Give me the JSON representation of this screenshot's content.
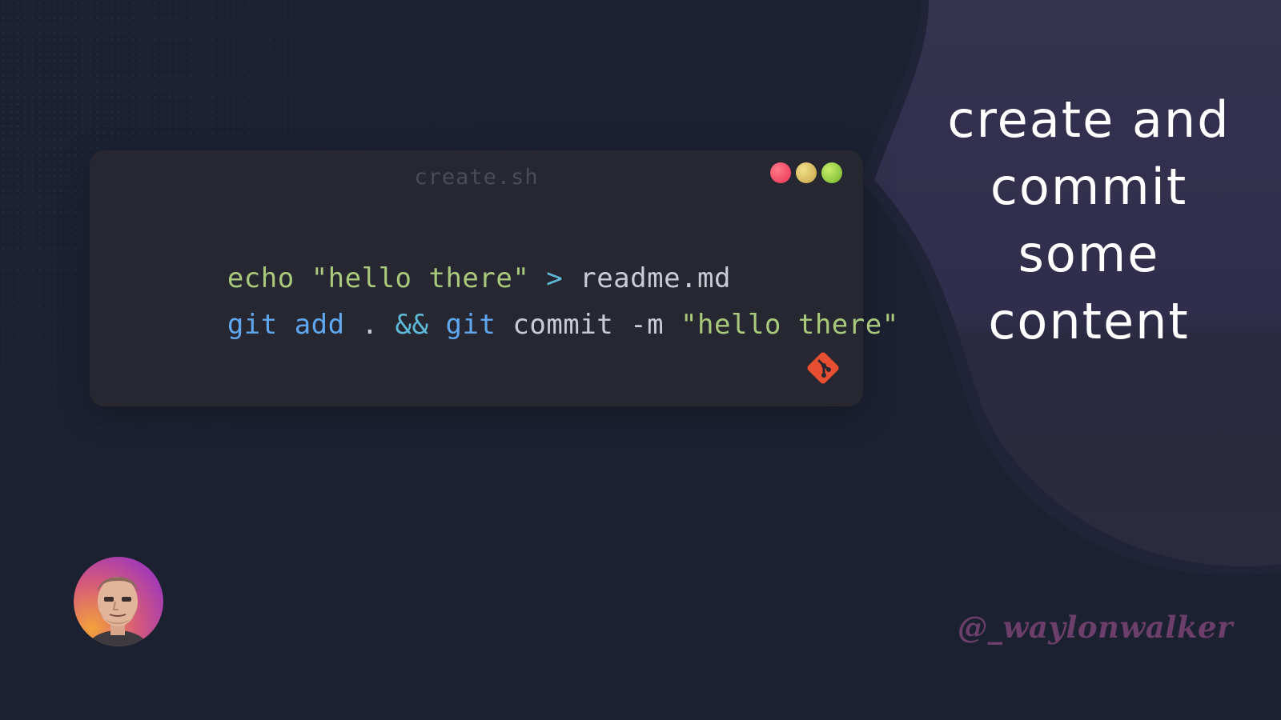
{
  "window": {
    "filename": "create.sh"
  },
  "code": {
    "line1": [
      {
        "text": "echo ",
        "kind": "green"
      },
      {
        "text": "\"hello there\"",
        "kind": "green"
      },
      {
        "text": " ",
        "kind": "plain"
      },
      {
        "text": ">",
        "kind": "cyan"
      },
      {
        "text": " readme.md",
        "kind": "plain"
      }
    ],
    "line2": [
      {
        "text": "git add",
        "kind": "blue"
      },
      {
        "text": " . ",
        "kind": "plain"
      },
      {
        "text": "&&",
        "kind": "cyan"
      },
      {
        "text": " ",
        "kind": "plain"
      },
      {
        "text": "git",
        "kind": "blue"
      },
      {
        "text": " commit -m ",
        "kind": "plain"
      },
      {
        "text": "\"hello there\"",
        "kind": "green"
      }
    ]
  },
  "title": {
    "line1": "create and",
    "line2": "commit",
    "line3": "some",
    "line4": "content"
  },
  "handle": "@_waylonwalker",
  "icons": {
    "logo": "git-logo-icon",
    "avatar": "avatar-illustration"
  },
  "colors": {
    "background": "#1c2132",
    "blob": "#2f2e4d",
    "code_window": "#262730",
    "title_text": "#ffffff",
    "handle_text": "#6b3f6a",
    "git_logo": "#e84e31"
  }
}
